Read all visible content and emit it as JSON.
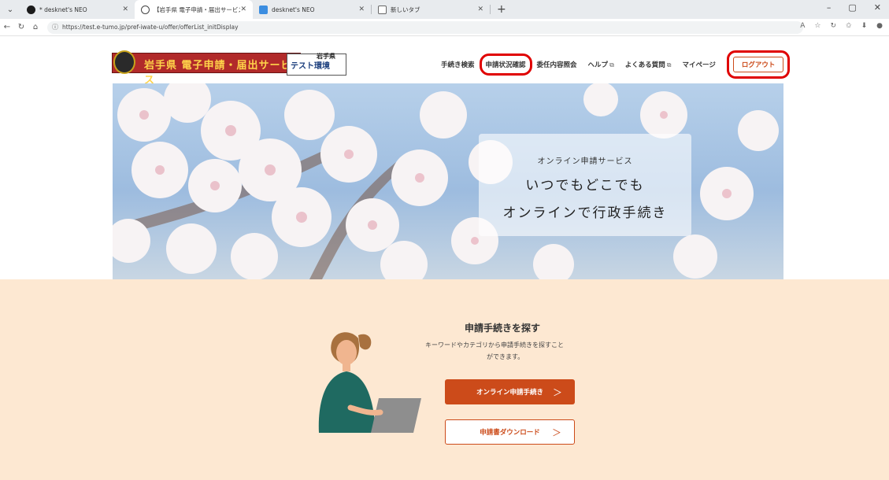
{
  "browser": {
    "tabs": [
      {
        "label": "* desknet's NEO",
        "active": false,
        "favicon_color": "#1b1b1b"
      },
      {
        "label": "【岩手県 電子申請・届出サービス (テ",
        "active": true,
        "favicon_color": "#444444"
      },
      {
        "label": "desknet's NEO",
        "active": false,
        "favicon_color": "#3b8de0"
      },
      {
        "label": "新しいタブ",
        "active": false,
        "favicon_color": "#666666"
      }
    ],
    "new_tab_symbol": "+",
    "url": "https://test.e-tumo.jp/pref-iwate-u/offer/offerList_initDisplay"
  },
  "header": {
    "logo_text": "岩手県 電子申請・届出サービス",
    "logo_badge": "テスト環境",
    "logo_pref": "岩手県",
    "nav": [
      {
        "label": "手続き検索",
        "external": false,
        "highlighted": false
      },
      {
        "label": "申請状況確認",
        "external": false,
        "highlighted": true
      },
      {
        "label": "委任内容照会",
        "external": false,
        "highlighted": false
      },
      {
        "label": "ヘルプ",
        "external": true,
        "highlighted": false
      },
      {
        "label": "よくある質問",
        "external": true,
        "highlighted": false
      },
      {
        "label": "マイページ",
        "external": false,
        "highlighted": false
      }
    ],
    "logout_label": "ログアウト",
    "external_icon": "⧉"
  },
  "hero": {
    "subtitle": "オンライン申請サービス",
    "title_line1": "いつでもどこでも",
    "title_line2": "オンラインで行政手続き"
  },
  "search_section": {
    "title": "申請手続きを探す",
    "description_line1": "キーワードやカテゴリから申請手続きを探すこと",
    "description_line2": "ができます。",
    "primary_button": "オンライン申請手続き",
    "secondary_button": "申請書ダウンロード",
    "chevron": "＞"
  },
  "colors": {
    "accent": "#cc4b1a",
    "highlight_box": "#e00000",
    "section_bg": "#fde8d2"
  }
}
